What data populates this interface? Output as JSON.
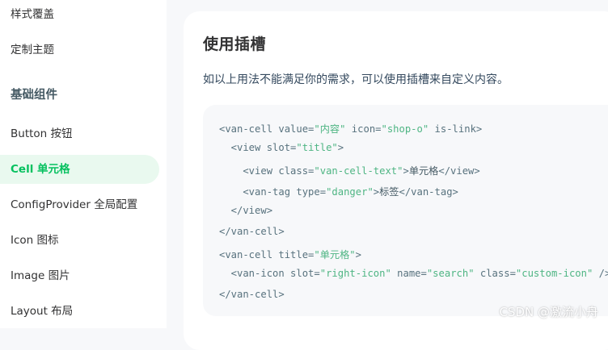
{
  "sidebar": {
    "items": [
      {
        "label": "样式覆盖",
        "type": "link"
      },
      {
        "label": "定制主题",
        "type": "link"
      },
      {
        "label": "基础组件",
        "type": "group"
      },
      {
        "label": "Button 按钮",
        "type": "link"
      },
      {
        "label": "Cell 单元格",
        "type": "active"
      },
      {
        "label": "ConfigProvider 全局配置",
        "type": "link"
      },
      {
        "label": "Icon 图标",
        "type": "link"
      },
      {
        "label": "Image 图片",
        "type": "link"
      },
      {
        "label": "Layout 布局",
        "type": "link"
      }
    ]
  },
  "content": {
    "title": "使用插槽",
    "description": "如以上用法不能满足你的需求，可以使用插槽来自定义内容。",
    "code_lines": [
      [
        "<van-cell value=",
        "\"内容\"",
        " icon=",
        "\"shop-o\"",
        " is-link>"
      ],
      [
        "  <view slot=",
        "\"title\"",
        ">"
      ],
      [
        "    <view class=",
        "\"van-cell-text\"",
        ">",
        "单元格",
        "</view>"
      ],
      [
        "    <van-tag type=",
        "\"danger\"",
        ">",
        "标签",
        "</van-tag>"
      ],
      [
        "  </view>"
      ],
      [
        "</van-cell>"
      ],
      [
        "<van-cell title=",
        "\"单元格\"",
        ">"
      ],
      [
        "  <van-icon slot=",
        "\"right-icon\"",
        " name=",
        "\"search\"",
        " class=",
        "\"custom-icon\"",
        " />"
      ],
      [
        "</van-cell>"
      ]
    ]
  },
  "watermark": "CSDN @激流小舟",
  "colors": {
    "accent": "#07c160",
    "active_bg": "#e9f9ef",
    "code_string": "#4eb583",
    "code_tag": "#58727e"
  }
}
